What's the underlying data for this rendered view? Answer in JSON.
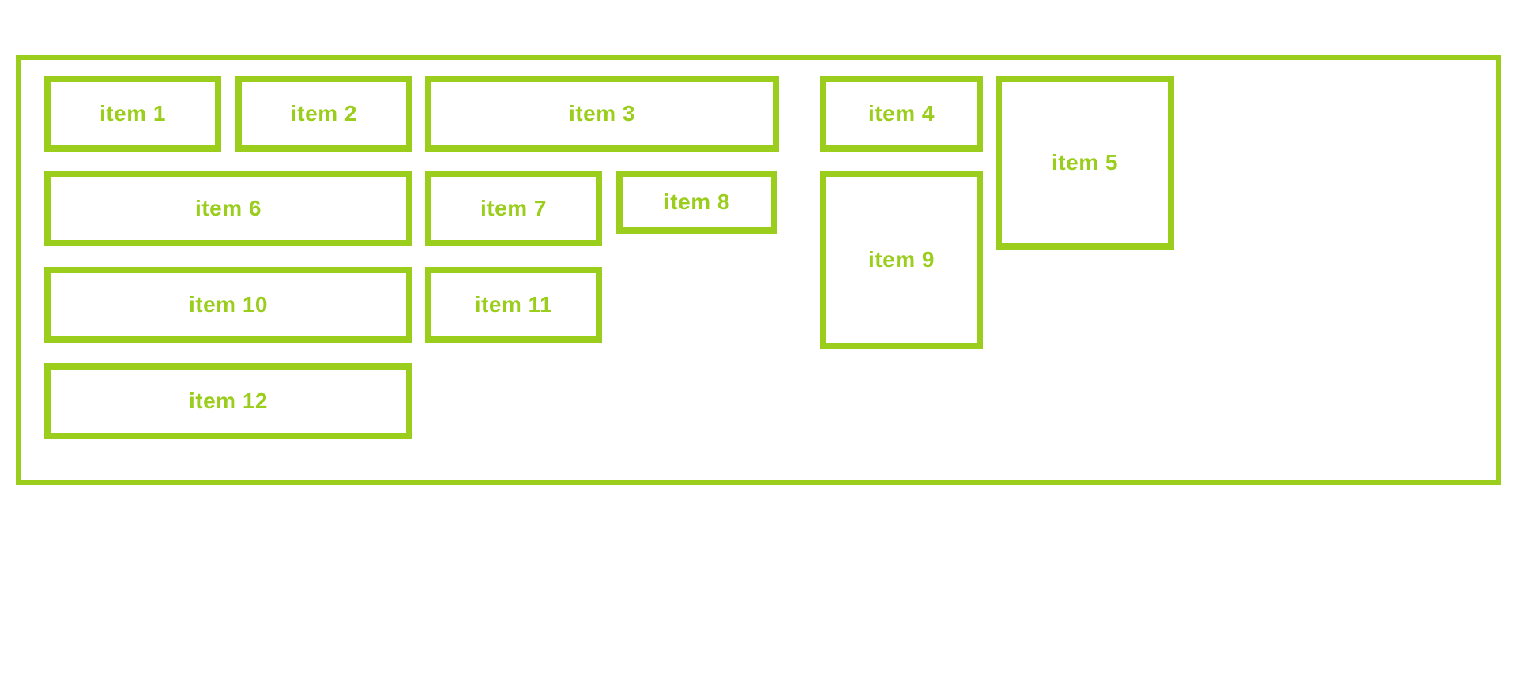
{
  "color": "#9acd1c",
  "items": {
    "i1": "item 1",
    "i2": "item 2",
    "i3": "item 3",
    "i4": "item 4",
    "i5": "item 5",
    "i6": "item 6",
    "i7": "item 7",
    "i8": "item 8",
    "i9": "item 9",
    "i10": "item 10",
    "i11": "item 11",
    "i12": "item 12"
  }
}
